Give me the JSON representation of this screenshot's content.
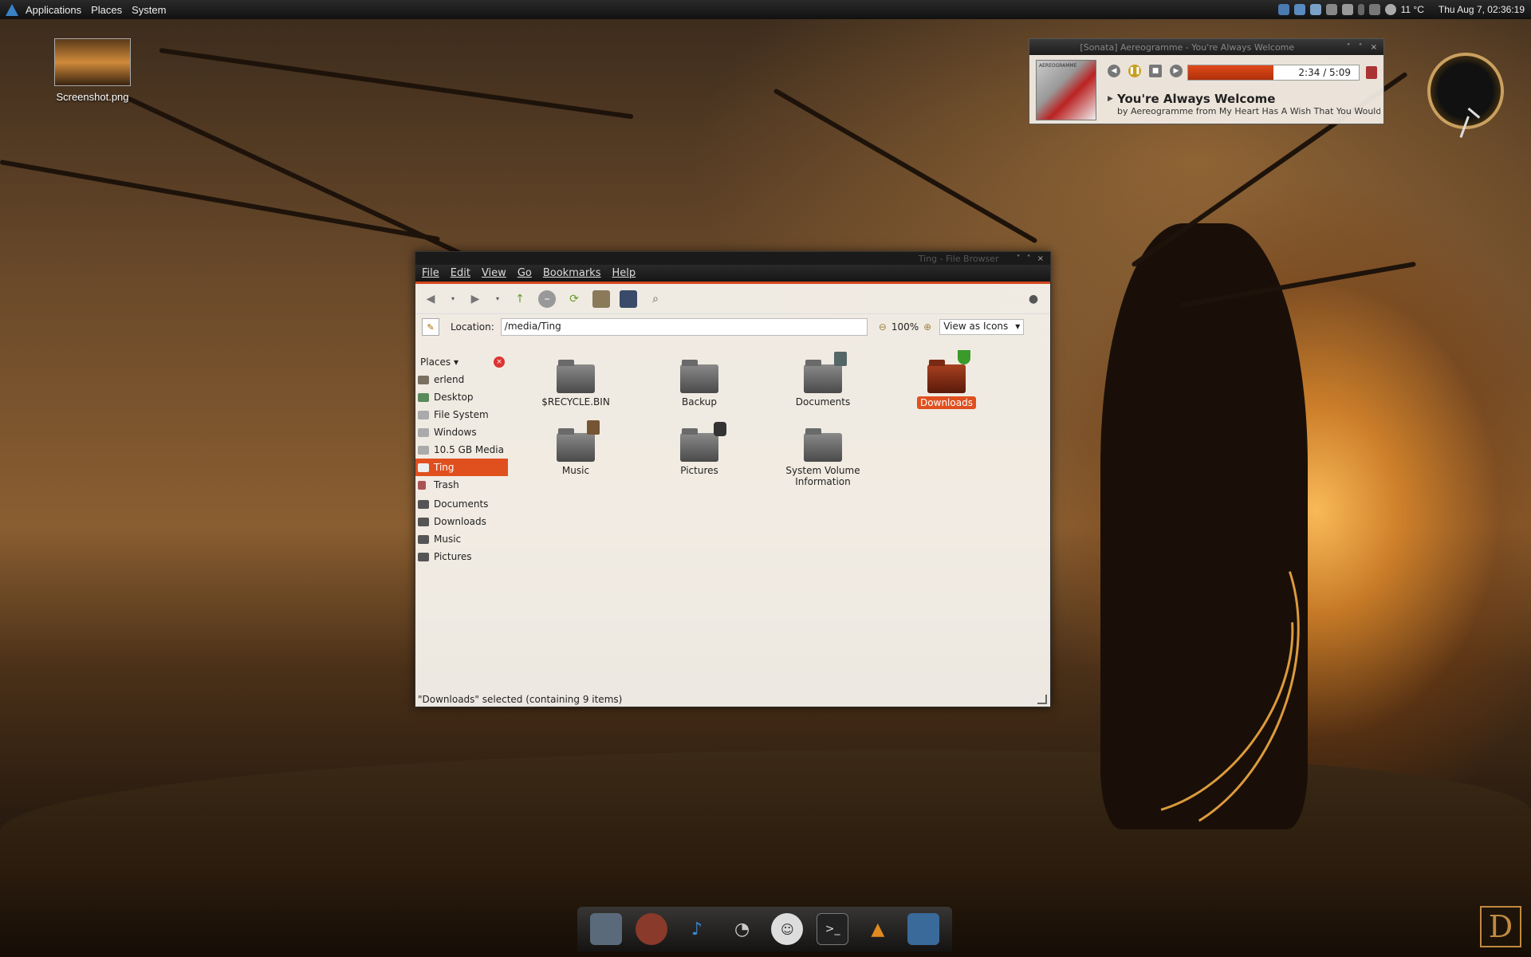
{
  "top_panel": {
    "menus": [
      "Applications",
      "Places",
      "System"
    ],
    "temperature": "11 °C",
    "clock": "Thu Aug  7, 02:36:19"
  },
  "desktop": {
    "icon_label": "Screenshot.png"
  },
  "player": {
    "window_title": "[Sonata] Aereogramme - You're Always Welcome",
    "elapsed": "2:34",
    "total": "5:09",
    "progress_fraction": 0.5,
    "song_title": "You're Always Welcome",
    "song_info": "by Aereogramme from My Heart Has A Wish That You Would Not...",
    "album_art_text": "AEREOGRAMME"
  },
  "file_browser": {
    "window_title": "Ting - File Browser",
    "menus": [
      "File",
      "Edit",
      "View",
      "Go",
      "Bookmarks",
      "Help"
    ],
    "location_label": "Location:",
    "location_value": "/media/Ting",
    "zoom": "100%",
    "view_mode": "View as Icons",
    "places_header": "Places",
    "places": [
      {
        "label": "erlend"
      },
      {
        "label": "Desktop"
      },
      {
        "label": "File System"
      },
      {
        "label": "Windows"
      },
      {
        "label": "10.5 GB Media"
      },
      {
        "label": "Ting",
        "selected": true
      },
      {
        "label": "Trash"
      },
      {
        "label": "Documents"
      },
      {
        "label": "Downloads"
      },
      {
        "label": "Music"
      },
      {
        "label": "Pictures"
      }
    ],
    "files": [
      {
        "label": "$RECYCLE.BIN"
      },
      {
        "label": "Backup"
      },
      {
        "label": "Documents"
      },
      {
        "label": "Downloads",
        "selected": true
      },
      {
        "label": "Music"
      },
      {
        "label": "Pictures"
      },
      {
        "label": "System Volume Information"
      }
    ],
    "status": "\"Downloads\" selected (containing 9 items)"
  },
  "dock": {
    "items": [
      "computer-icon",
      "firefox-icon",
      "music-icon",
      "satellite-icon",
      "chat-icon",
      "terminal-icon",
      "vlc-icon",
      "folder-icon"
    ]
  },
  "colors": {
    "accent": "#e0501f",
    "panel": "#161616"
  }
}
